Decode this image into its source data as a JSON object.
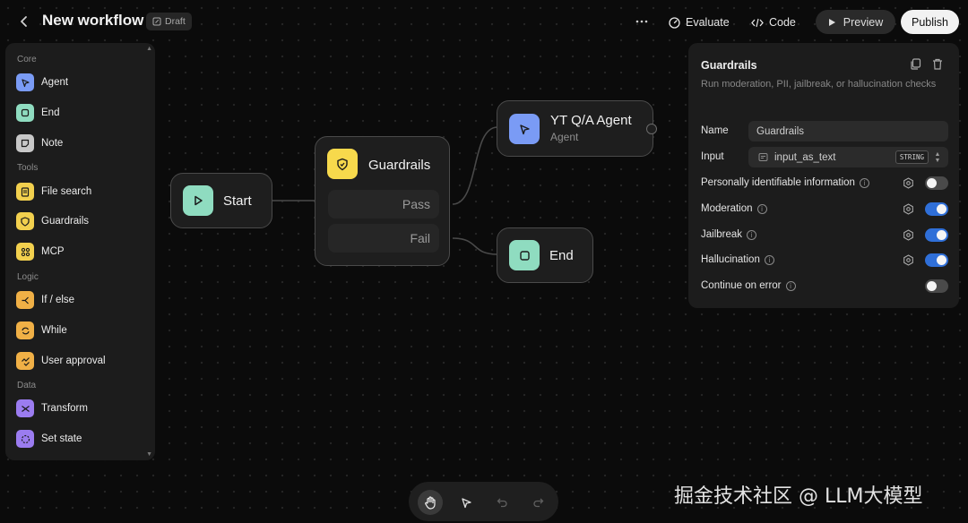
{
  "header": {
    "title": "New workflow",
    "draft_label": "Draft",
    "evaluate_label": "Evaluate",
    "code_label": "Code",
    "preview_label": "Preview",
    "publish_label": "Publish"
  },
  "sidebar": {
    "sections": {
      "core": "Core",
      "tools": "Tools",
      "logic": "Logic",
      "data": "Data"
    },
    "items": [
      {
        "label": "Agent",
        "icon": "cursor-icon",
        "color": "#7a9bf5"
      },
      {
        "label": "End",
        "icon": "square-icon",
        "color": "#8fdcc0"
      },
      {
        "label": "Note",
        "icon": "note-icon",
        "color": "#c8c8c8"
      },
      {
        "label": "File search",
        "icon": "file-icon",
        "color": "#f2d04e"
      },
      {
        "label": "Guardrails",
        "icon": "shield-icon",
        "color": "#f2d04e"
      },
      {
        "label": "MCP",
        "icon": "mcp-icon",
        "color": "#f2d04e"
      },
      {
        "label": "If / else",
        "icon": "branch-icon",
        "color": "#f0b046"
      },
      {
        "label": "While",
        "icon": "loop-icon",
        "color": "#f0b046"
      },
      {
        "label": "User approval",
        "icon": "approval-icon",
        "color": "#f0b046"
      },
      {
        "label": "Transform",
        "icon": "shuffle-icon",
        "color": "#9b7cf0"
      },
      {
        "label": "Set state",
        "icon": "state-icon",
        "color": "#9b7cf0"
      }
    ]
  },
  "canvas": {
    "start_node": {
      "title": "Start",
      "color": "#8fdcc0"
    },
    "guardrails_node": {
      "title": "Guardrails",
      "pass_label": "Pass",
      "fail_label": "Fail",
      "color": "#f7d94c"
    },
    "agent_node": {
      "title": "YT Q/A Agent",
      "subtitle": "Agent",
      "color": "#7a9bf5"
    },
    "end_node": {
      "title": "End",
      "color": "#8fdcc0"
    }
  },
  "panel": {
    "title": "Guardrails",
    "description": "Run moderation, PII, jailbreak, or hallucination checks",
    "name_label": "Name",
    "name_value": "Guardrails",
    "input_label": "Input",
    "input_value": "input_as_text",
    "input_type": "STRING",
    "options": [
      {
        "label": "Personally identifiable information",
        "enabled": false
      },
      {
        "label": "Moderation",
        "enabled": true
      },
      {
        "label": "Jailbreak",
        "enabled": true
      },
      {
        "label": "Hallucination",
        "enabled": true
      }
    ],
    "continue_on_error": {
      "label": "Continue on error",
      "enabled": false
    },
    "toggle_on_color": "#2f6fd8"
  },
  "toolbar": {
    "tools": [
      "hand-icon",
      "pointer-icon",
      "undo-icon",
      "redo-icon"
    ],
    "active": "hand-icon"
  },
  "watermark": "掘金技术社区 @ LLM大模型"
}
